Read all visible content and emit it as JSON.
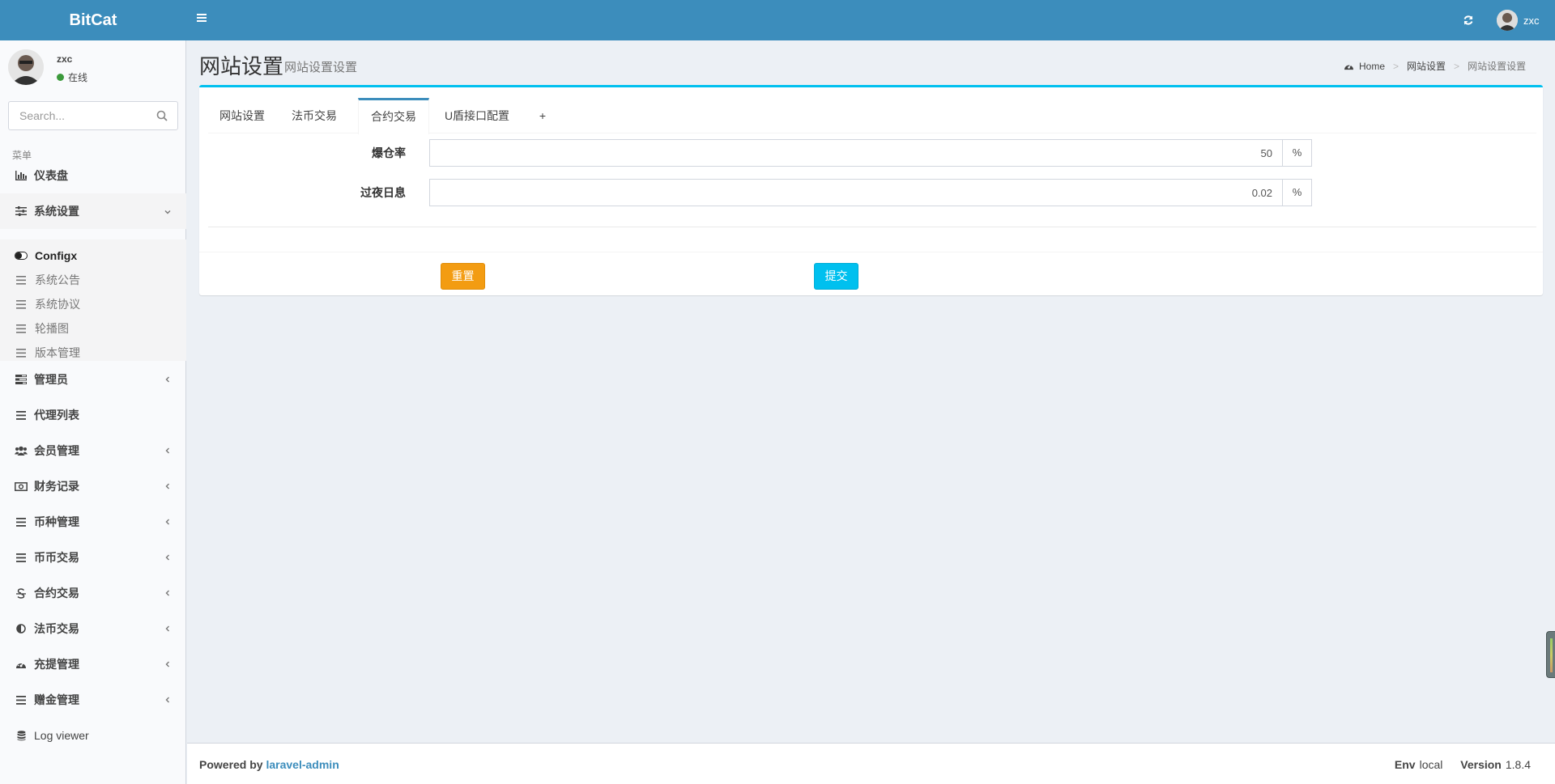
{
  "header": {
    "logo": "BitCat",
    "user_name": "zxc"
  },
  "sidebar": {
    "user": {
      "name": "zxc",
      "status": "在线"
    },
    "search_placeholder": "Search...",
    "menu_header": "菜单",
    "items": [
      {
        "label": "仪表盘",
        "icon": "bar-chart-icon"
      },
      {
        "label": "系统设置",
        "icon": "sliders-icon",
        "expanded": true,
        "children": [
          {
            "label": "Configx",
            "icon": "toggle-icon",
            "current": true
          },
          {
            "label": "系统公告",
            "icon": "list-icon"
          },
          {
            "label": "系统协议",
            "icon": "list-icon"
          },
          {
            "label": "轮播图",
            "icon": "list-icon"
          },
          {
            "label": "版本管理",
            "icon": "list-icon"
          }
        ]
      },
      {
        "label": "管理员",
        "icon": "tasks-icon"
      },
      {
        "label": "代理列表",
        "icon": "list-icon"
      },
      {
        "label": "会员管理",
        "icon": "users-icon"
      },
      {
        "label": "财务记录",
        "icon": "money-icon"
      },
      {
        "label": "币种管理",
        "icon": "list-icon"
      },
      {
        "label": "币币交易",
        "icon": "list-icon"
      },
      {
        "label": "合约交易",
        "icon": "strikethrough-icon"
      },
      {
        "label": "法币交易",
        "icon": "adjust-icon"
      },
      {
        "label": "充提管理",
        "icon": "dashboard-icon"
      },
      {
        "label": "赠金管理",
        "icon": "list-icon"
      },
      {
        "label": "Log viewer",
        "icon": "database-icon"
      }
    ]
  },
  "content": {
    "title": "网站设置",
    "subtitle": "网站设置设置",
    "breadcrumb": [
      "Home",
      "网站设置",
      "网站设置设置"
    ]
  },
  "tabs": [
    "网站设置",
    "法币交易",
    "合约交易",
    "U盾接口配置",
    "+"
  ],
  "active_tab": "合约交易",
  "form": {
    "fields": [
      {
        "label": "爆仓率",
        "value": "50",
        "addon": "%"
      },
      {
        "label": "过夜日息",
        "value": "0.02",
        "addon": "%"
      }
    ],
    "reset_label": "重置",
    "submit_label": "提交"
  },
  "footer": {
    "powered_by": "Powered by",
    "link_text": "laravel-admin",
    "env_label": "Env",
    "env_value": "local",
    "version_label": "Version",
    "version_value": "1.8.4"
  },
  "colors": {
    "header": "#3c8dbc",
    "box_top": "#00c0ef",
    "reset": "#f39c12",
    "submit": "#00c0ef"
  }
}
